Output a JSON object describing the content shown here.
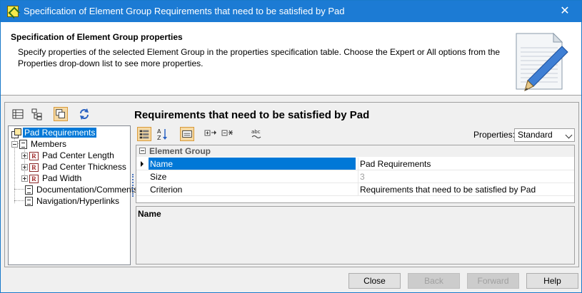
{
  "window": {
    "title": "Specification of Element Group Requirements that need to be satisfied by Pad",
    "close_glyph": "✕"
  },
  "header": {
    "title": "Specification of Element Group properties",
    "description": "Specify properties of the selected Element Group in the properties specification table. Choose the Expert or All options from the Properties drop-down list to see more properties."
  },
  "tree": {
    "items": [
      {
        "label": "Pad Requirements",
        "icon": "element-group-icon",
        "selected": true
      },
      {
        "label": "Members",
        "icon": "page-icon"
      },
      {
        "label": "Pad Center Length",
        "icon": "requirement-icon",
        "icon_letter": "R"
      },
      {
        "label": "Pad Center Thickness",
        "icon": "requirement-icon",
        "icon_letter": "R"
      },
      {
        "label": "Pad Width",
        "icon": "requirement-icon",
        "icon_letter": "R"
      },
      {
        "label": "Documentation/Comments",
        "icon": "page-icon"
      },
      {
        "label": "Navigation/Hyperlinks",
        "icon": "page-icon"
      }
    ]
  },
  "right": {
    "title": "Requirements that need to be satisfied by Pad",
    "properties_label": "Properties:",
    "properties_value": "Standard",
    "group_header": "Element Group",
    "rows": [
      {
        "name": "Name",
        "value": "Pad Requirements",
        "selected": true
      },
      {
        "name": "Size",
        "value": "3",
        "disabled": true
      },
      {
        "name": "Criterion",
        "value": "Requirements that need to be satisfied by Pad"
      }
    ],
    "description_label": "Name"
  },
  "footer": {
    "close": "Close",
    "back": "Back",
    "forward": "Forward",
    "help": "Help"
  }
}
